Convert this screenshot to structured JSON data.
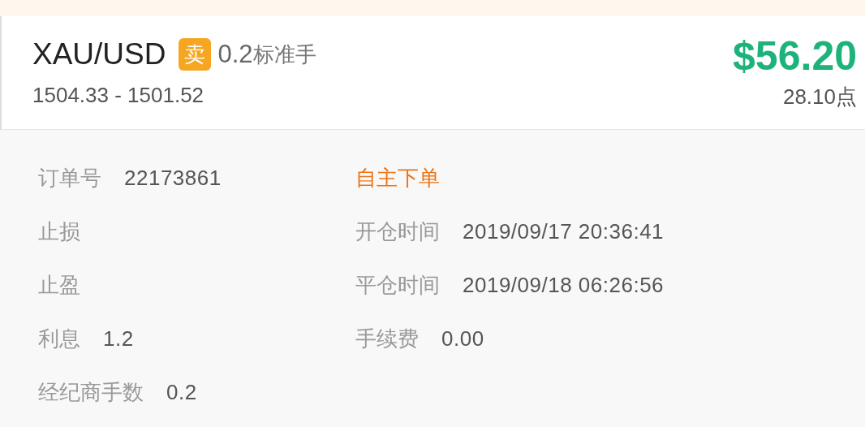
{
  "trade": {
    "symbol": "XAU/USD",
    "side": "卖",
    "lots": "0.2",
    "lot_unit": "标准手",
    "price_range": "1504.33 - 1501.52",
    "profit": "$56.20",
    "points": "28.10点"
  },
  "details": {
    "left": [
      {
        "label": "订单号",
        "value": "22173861"
      },
      {
        "label": "止损"
      },
      {
        "label": "止盈"
      },
      {
        "label": "利息",
        "value": "1.2"
      },
      {
        "label": "经纪商手数",
        "value": "0.2"
      }
    ],
    "right": [
      {
        "kind": "tag",
        "text": "自主下单"
      },
      {
        "kind": "field",
        "label": "开仓时间",
        "value": "2019/09/17 20:36:41"
      },
      {
        "kind": "field",
        "label": "平仓时间",
        "value": "2019/09/18 06:26:56"
      },
      {
        "kind": "field",
        "label": "手续费",
        "value": "0.00"
      }
    ]
  }
}
